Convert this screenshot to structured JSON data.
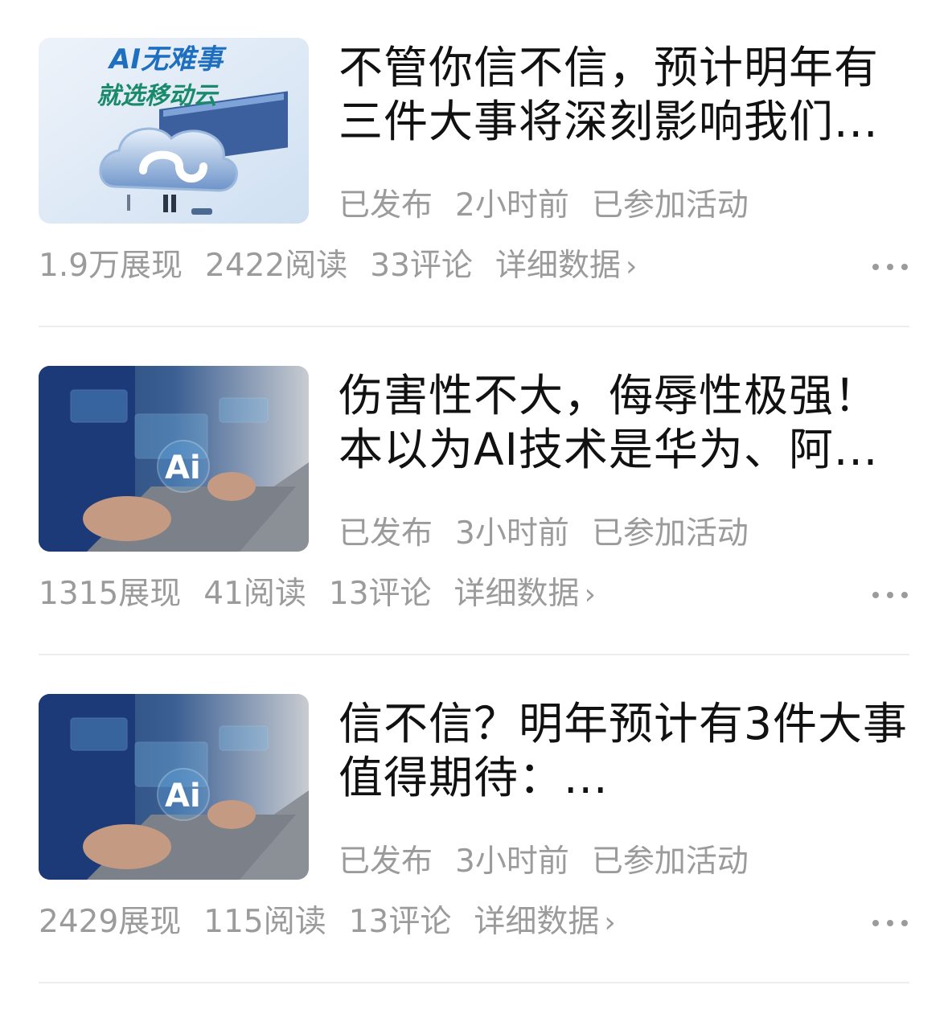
{
  "articles": [
    {
      "title": "不管你信不信，预计明年有三件大事将深刻影响我们...",
      "status": "已发布",
      "time": "2小时前",
      "activity": "已参加活动",
      "impressions": "1.9万展现",
      "reads": "2422阅读",
      "comments": "33评论",
      "detail_label": "详细数据",
      "thumb_text_line1": "AI无难事",
      "thumb_text_line2": "就选移动云"
    },
    {
      "title": "伤害性不大，侮辱性极强！本以为AI技术是华为、阿...",
      "status": "已发布",
      "time": "3小时前",
      "activity": "已参加活动",
      "impressions": "1315展现",
      "reads": "41阅读",
      "comments": "13评论",
      "detail_label": "详细数据",
      "thumb_text": "Ai"
    },
    {
      "title": "信不信？明年预计有3件大事值得期待：...",
      "status": "已发布",
      "time": "3小时前",
      "activity": "已参加活动",
      "impressions": "2429展现",
      "reads": "115阅读",
      "comments": "13评论",
      "detail_label": "详细数据",
      "thumb_text": "Ai"
    }
  ]
}
